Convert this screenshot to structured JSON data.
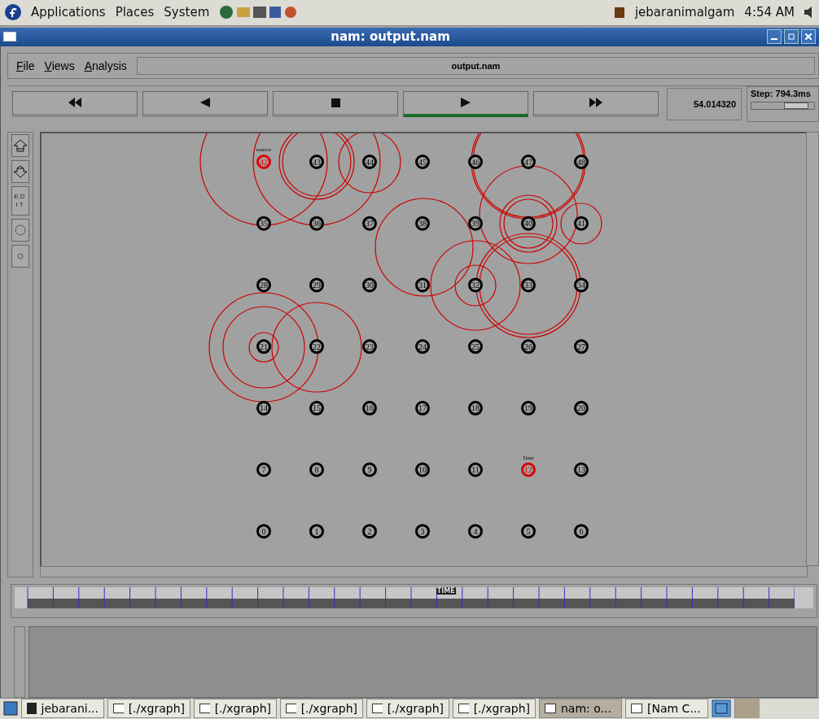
{
  "top_panel": {
    "menus": [
      "Applications",
      "Places",
      "System"
    ],
    "user": "jebaranimalgam",
    "clock": "4:54 AM"
  },
  "window": {
    "title": "nam: output.nam"
  },
  "menu_bar": {
    "items": [
      "File",
      "Views",
      "Analysis"
    ],
    "file_name": "output.nam"
  },
  "playback": {
    "buttons": [
      {
        "kind": "rewind",
        "selected": false
      },
      {
        "kind": "back",
        "selected": false
      },
      {
        "kind": "stop",
        "selected": false
      },
      {
        "kind": "play",
        "selected": true
      },
      {
        "kind": "forward",
        "selected": false
      }
    ],
    "time": "54.014320",
    "step": "Step: 794.3ms",
    "step_level": {
      "level": 0.85
    }
  },
  "tools": [
    {
      "kind": "zoom-in"
    },
    {
      "kind": "zoom-out"
    },
    {
      "kind": "edit",
      "label": "ED IT"
    },
    {
      "kind": "big-circle"
    },
    {
      "kind": "small-circle"
    }
  ],
  "nodes": [
    {
      "label": "42",
      "tag": "source",
      "highlighted": true
    },
    {
      "label": "43",
      "highlighted": false
    },
    {
      "label": "44",
      "highlighted": false
    },
    {
      "label": "45",
      "highlighted": false
    },
    {
      "label": "46",
      "highlighted": false
    },
    {
      "label": "47",
      "highlighted": false
    },
    {
      "label": "48",
      "highlighted": false
    },
    {
      "label": "35",
      "highlighted": false
    },
    {
      "label": "36",
      "highlighted": false
    },
    {
      "label": "37",
      "highlighted": false
    },
    {
      "label": "38",
      "highlighted": false
    },
    {
      "label": "39",
      "highlighted": false
    },
    {
      "label": "40",
      "highlighted": false
    },
    {
      "label": "41",
      "highlighted": false
    },
    {
      "label": "28",
      "highlighted": false
    },
    {
      "label": "29",
      "highlighted": false
    },
    {
      "label": "30",
      "highlighted": false
    },
    {
      "label": "31",
      "highlighted": false
    },
    {
      "label": "32",
      "highlighted": false
    },
    {
      "label": "33",
      "highlighted": false
    },
    {
      "label": "34",
      "highlighted": false
    },
    {
      "label": "21",
      "highlighted": false
    },
    {
      "label": "22",
      "highlighted": false
    },
    {
      "label": "23",
      "highlighted": false
    },
    {
      "label": "24",
      "highlighted": false
    },
    {
      "label": "25",
      "highlighted": false
    },
    {
      "label": "26",
      "highlighted": false
    },
    {
      "label": "27",
      "highlighted": false
    },
    {
      "label": "14",
      "highlighted": false
    },
    {
      "label": "15",
      "highlighted": false
    },
    {
      "label": "16",
      "highlighted": false
    },
    {
      "label": "17",
      "highlighted": false
    },
    {
      "label": "18",
      "highlighted": false
    },
    {
      "label": "19",
      "highlighted": false
    },
    {
      "label": "20",
      "highlighted": false
    },
    {
      "label": "7",
      "highlighted": false
    },
    {
      "label": "8",
      "highlighted": false
    },
    {
      "label": "9",
      "highlighted": false
    },
    {
      "label": "10",
      "highlighted": false
    },
    {
      "label": "11",
      "highlighted": false
    },
    {
      "label": "12",
      "tag": "Dest",
      "highlighted": true
    },
    {
      "label": "13",
      "highlighted": false
    },
    {
      "label": "0",
      "highlighted": false
    },
    {
      "label": "1",
      "highlighted": false
    },
    {
      "label": "2",
      "highlighted": false
    },
    {
      "label": "3",
      "highlighted": false
    },
    {
      "label": "4",
      "highlighted": false
    },
    {
      "label": "5",
      "highlighted": false
    },
    {
      "label": "6",
      "highlighted": false
    }
  ],
  "time_slider": {
    "label": "TIME",
    "level": 0.54
  },
  "taskbar": [
    {
      "kind": "terminal",
      "label": "jebarani...",
      "selected": false
    },
    {
      "kind": "window",
      "label": "[./xgraph]",
      "selected": false
    },
    {
      "kind": "window",
      "label": "[./xgraph]",
      "selected": false
    },
    {
      "kind": "window",
      "label": "[./xgraph]",
      "selected": false
    },
    {
      "kind": "window",
      "label": "[./xgraph]",
      "selected": false
    },
    {
      "kind": "window",
      "label": "[./xgraph]",
      "selected": false
    },
    {
      "kind": "window",
      "label": "nam: o...",
      "selected": true
    },
    {
      "kind": "window",
      "label": "[Nam C...",
      "selected": false
    }
  ]
}
